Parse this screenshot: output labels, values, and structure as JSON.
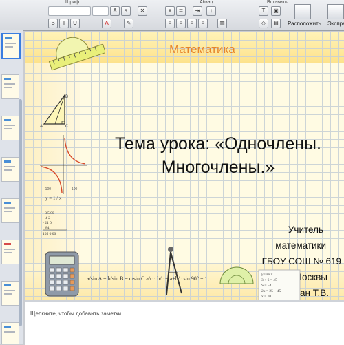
{
  "ribbon": {
    "font_group_label": "Шрифт",
    "paragraph_group_label": "Абзац",
    "insert_group_label": "Вставить",
    "arrange_label": "Расположить",
    "express_label": "Экспре",
    "text_label": "Т"
  },
  "slide": {
    "heading": "Математика",
    "title_line1": "Тема урока: «Одночлены.",
    "title_line2": "Многочлены.»",
    "author_line1": "Учитель",
    "author_line2": "математики",
    "author_line3": "ГБОУ СОШ № 619",
    "author_line4": "г.Москвы",
    "author_line5": "Рудьман Т.В.",
    "graph_caption": "y = 1 / x",
    "bottom_formulas": "a/sin A = b/sin B = c/sin C     a/c · b/c = a+b/c     sin 90° = 1",
    "notepad_lines": "y=sin x\n3 + 6 = 45\nS = 54\n2x = 25 + 45\nx = 70"
  },
  "notes": {
    "placeholder": "Щелкните, чтобы добавить заметки"
  },
  "colors": {
    "heading": "#e6852b",
    "slide_bg": "#fffbe3",
    "grid": "#c8d1d6",
    "selection": "#3a7de0"
  }
}
